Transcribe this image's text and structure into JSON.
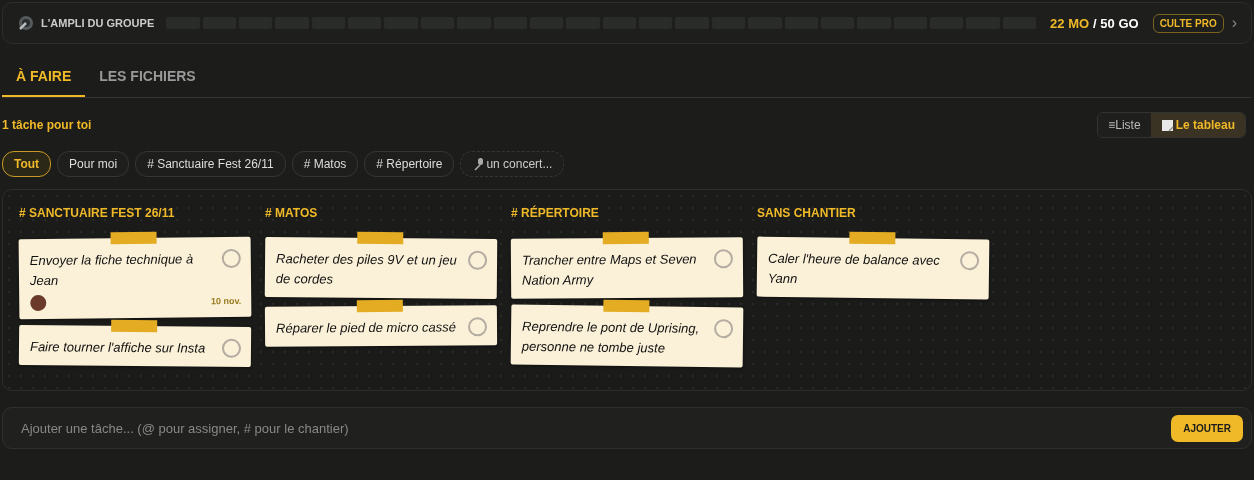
{
  "header": {
    "title": "L'AMPLI DU GROUPE",
    "storage": {
      "level": 0,
      "used": "22 MO",
      "total": "/ 50 GO"
    },
    "plan_badge": "CULTE PRO",
    "chevron": "›"
  },
  "tabs": [
    {
      "label": "À FAIRE",
      "selected": true
    },
    {
      "label": "LES FICHIERS",
      "selected": false
    }
  ],
  "summary": "1 tâche pour toi",
  "view_toggle": [
    {
      "label": "Liste",
      "icon": "≡",
      "selected": false
    },
    {
      "label": "Le tableau",
      "selected": true
    }
  ],
  "filters": [
    {
      "kind": "pill",
      "label": "Tout",
      "selected": true
    },
    {
      "kind": "pill",
      "label": "Pour moi",
      "selected": false
    },
    {
      "kind": "pill",
      "label": "# Sanctuaire Fest 26/11",
      "selected": false
    },
    {
      "kind": "pill",
      "label": "# Matos",
      "selected": false
    },
    {
      "kind": "pill",
      "label": "# Répertoire",
      "selected": false
    },
    {
      "kind": "suggestion",
      "label": "un concert...",
      "selected": false
    }
  ],
  "columns": [
    {
      "title": "# SANCTUAIRE FEST 26/11",
      "cards": [
        {
          "text": "Envoyer la fiche technique à Jean",
          "checked": false,
          "avatar": true,
          "date": "10 nov."
        },
        {
          "text": "Faire tourner l'affiche sur Insta",
          "checked": false
        }
      ]
    },
    {
      "title": "# MATOS",
      "cards": [
        {
          "text": "Racheter des piles 9V et un jeu de cordes",
          "checked": false
        },
        {
          "text": "Réparer le pied de micro cassé",
          "checked": false
        }
      ]
    },
    {
      "title": "# RÉPERTOIRE",
      "cards": [
        {
          "text": "Trancher entre Maps et Seven Nation Army",
          "checked": false
        },
        {
          "text": "Reprendre le pont de Uprising, personne ne tombe juste",
          "checked": false
        }
      ]
    },
    {
      "title": "SANS CHANTIER",
      "cards": [
        {
          "text": "Caler l'heure de balance avec Yann",
          "checked": false
        }
      ]
    }
  ],
  "composer": {
    "placeholder": "Ajouter une tâche... (@ pour assigner, # pour le chantier)",
    "button": "AJOUTER"
  }
}
